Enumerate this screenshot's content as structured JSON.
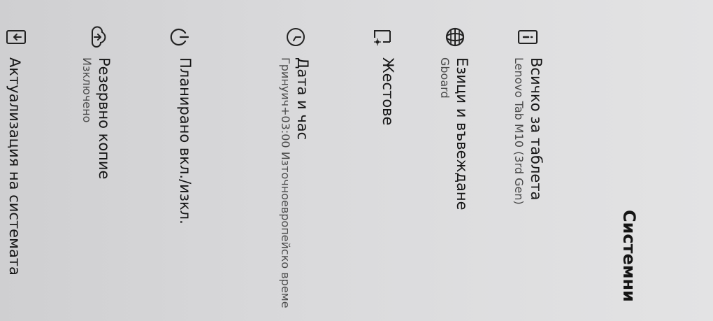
{
  "page": {
    "title": "Системни"
  },
  "items": [
    {
      "label": "Всичко за таблета",
      "summary": "Lenovo Tab M10 (3rd Gen)",
      "icon": "tablet-info-icon"
    },
    {
      "label": "Езици и въвеждане",
      "summary": "Gboard",
      "icon": "globe-icon"
    },
    {
      "label": "Жестове",
      "summary": "",
      "icon": "gestures-icon"
    },
    {
      "label": "Дата и час",
      "summary": "Гринуич+03:00 Източноевропейско време",
      "icon": "clock-icon"
    },
    {
      "label": "Планирано вкл./изкл.",
      "summary": "",
      "icon": "power-icon"
    },
    {
      "label": "Резервно копие",
      "summary": "Изключено",
      "icon": "cloud-backup-icon"
    },
    {
      "label": "Актуализация на системата",
      "summary": "",
      "icon": "system-update-icon"
    }
  ]
}
